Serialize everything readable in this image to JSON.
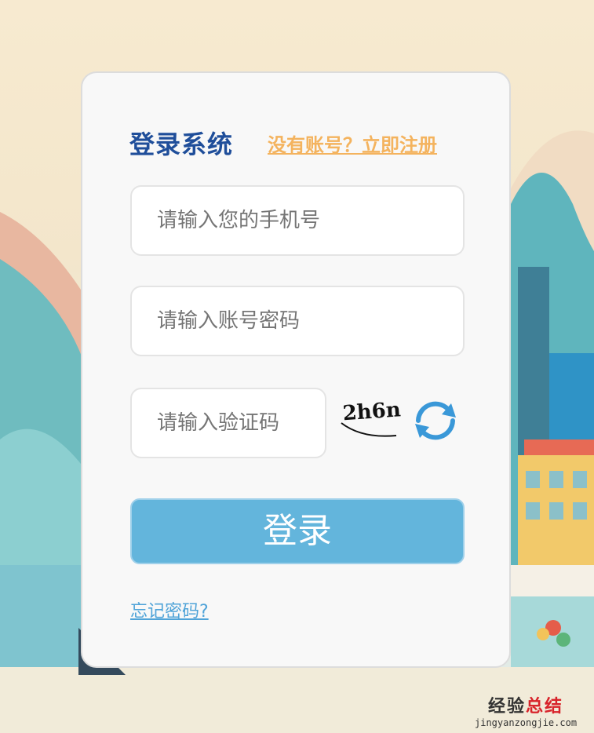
{
  "login": {
    "title": "登录系统",
    "register_link": "没有账号？立即注册",
    "phone_placeholder": "请输入您的手机号",
    "password_placeholder": "请输入账号密码",
    "captcha_placeholder": "请输入验证码",
    "captcha_text": "2h6n",
    "submit_label": "登录",
    "forgot_link": "忘记密码?"
  },
  "watermark": {
    "main_prefix": "经验",
    "main_suffix": "总结",
    "url": "jingyanzongjie.com"
  },
  "colors": {
    "title": "#1f4e9a",
    "register": "#f4b35e",
    "button": "#63b5dc",
    "link": "#4fa3d8",
    "refresh_icon": "#3a98d8"
  }
}
